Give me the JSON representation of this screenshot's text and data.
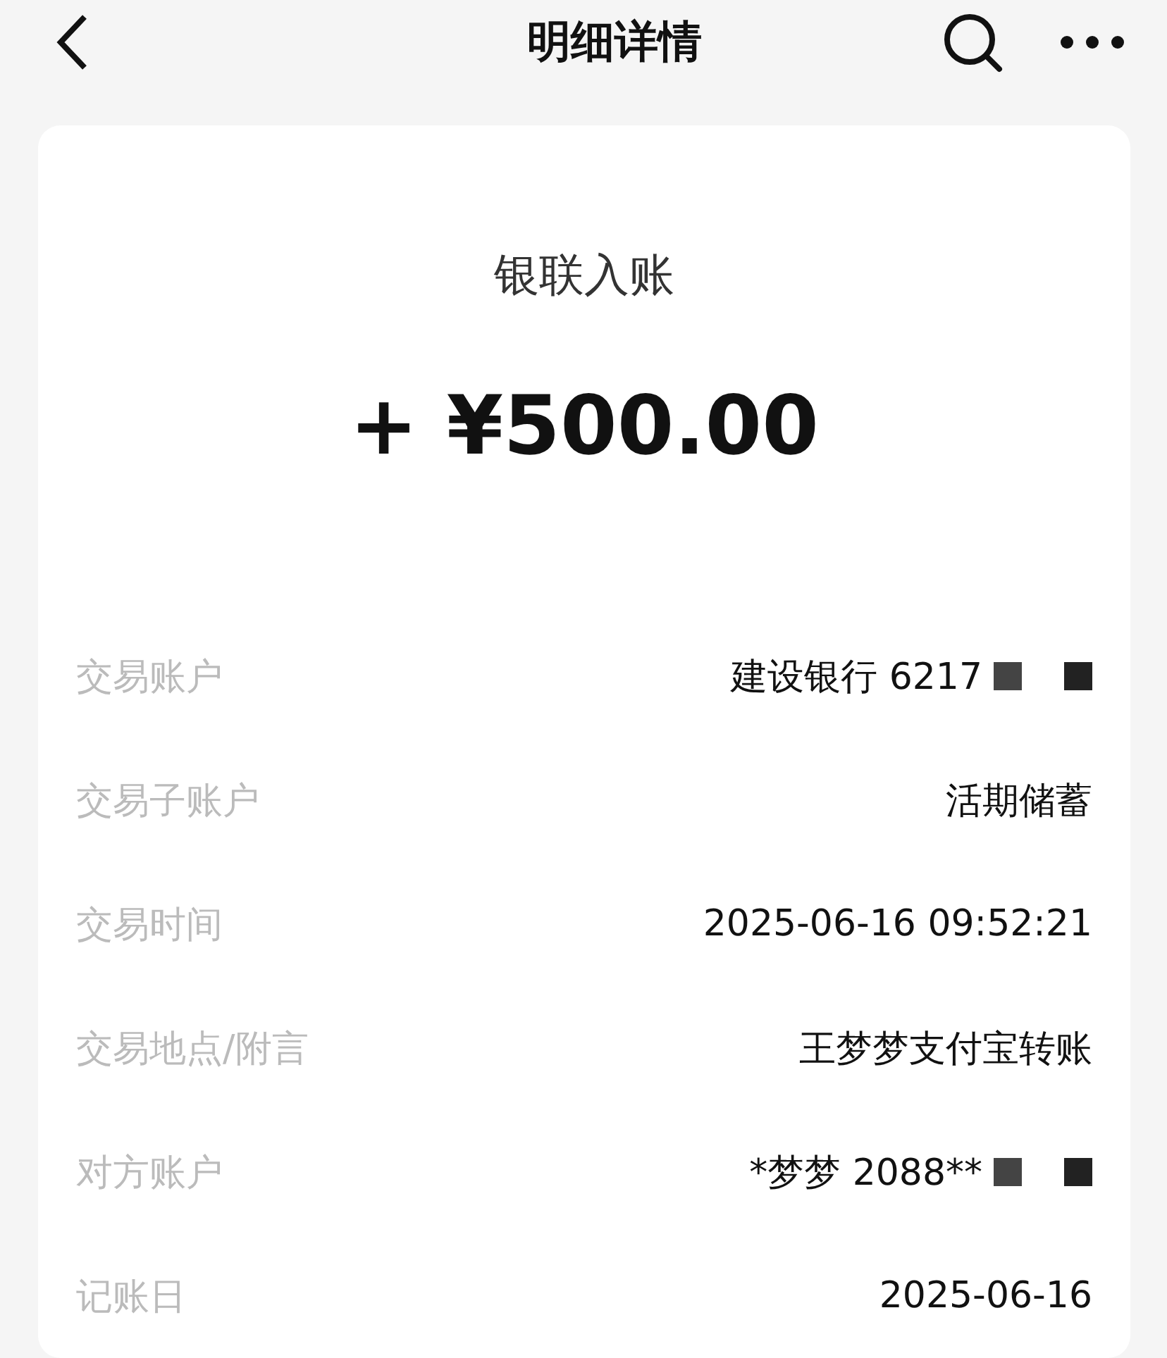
{
  "nav": {
    "title": "明细详情"
  },
  "summary": {
    "type": "银联入账",
    "amount": "+ ¥500.00"
  },
  "rows": [
    {
      "label": "交易账户",
      "value": "建设银行 6217",
      "redacted": true
    },
    {
      "label": "交易子账户",
      "value": "活期储蓄",
      "redacted": false
    },
    {
      "label": "交易时间",
      "value": "2025-06-16 09:52:21",
      "redacted": false
    },
    {
      "label": "交易地点/附言",
      "value": "王梦梦支付宝转账",
      "redacted": false
    },
    {
      "label": "对方账户",
      "value": "*梦梦 2088**",
      "redacted": true
    },
    {
      "label": "记账日",
      "value": "2025-06-16",
      "redacted": false
    }
  ]
}
